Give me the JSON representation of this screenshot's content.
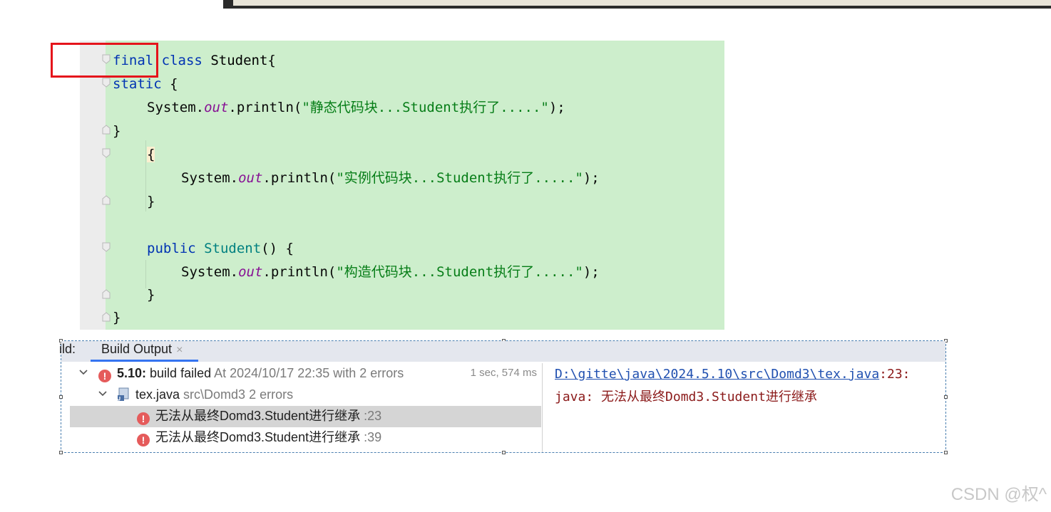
{
  "editor": {
    "lines": {
      "l1_kw": "final",
      "l1_kw2": "class",
      "l1_name": "Student",
      "l1_brace": "{",
      "l2_kw": "static",
      "l2_brace": "{",
      "l3_pre": "System.",
      "l3_field": "out",
      "l3_mid": ".println(",
      "l3_str": "\"静态代码块...Student执行了.....\"",
      "l3_end": ");",
      "l4": "}",
      "l5": "{",
      "l6_pre": "System.",
      "l6_field": "out",
      "l6_mid": ".println(",
      "l6_str": "\"实例代码块...Student执行了.....\"",
      "l6_end": ");",
      "l7": "}",
      "l8_kw": "public",
      "l8_name": "Student",
      "l8_rest": "() {",
      "l9_pre": "System.",
      "l9_field": "out",
      "l9_mid": ".println(",
      "l9_str": "\"构造代码块...Student执行了.....\"",
      "l9_end": ");",
      "l10": "}",
      "l11": "}"
    }
  },
  "build": {
    "tab_prefix": "ild:",
    "tab_label": "Build Output",
    "tab_close": "×",
    "rows": [
      {
        "title": "5.10:",
        "text": " build failed",
        "detail": " At 2024/10/17 22:35 with 2 errors",
        "duration": "1 sec, 574 ms"
      },
      {
        "title": "tex.java",
        "detail": " src\\Domd3 2 errors"
      },
      {
        "text": "无法从最终Domd3.Student进行继承",
        "detail": " :23"
      },
      {
        "text": "无法从最终Domd3.Student进行继承",
        "detail": " :39"
      }
    ],
    "detail_link": "D:\\gitte\\java\\2024.5.10\\src\\Domd3\\tex.java",
    "detail_link_suffix": ":23:",
    "detail_message": "java: 无法从最终Domd3.Student进行继承",
    "error_icon_glyph": "!",
    "error_color": "#e55b5b"
  },
  "watermark": "CSDN @权^"
}
